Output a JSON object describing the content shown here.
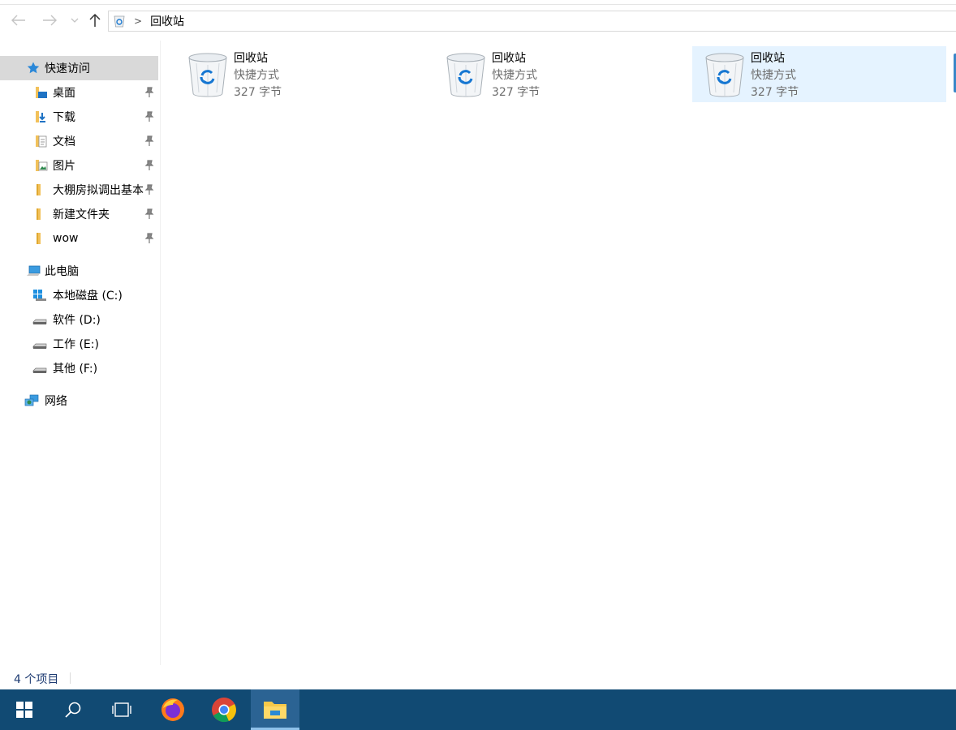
{
  "address": {
    "path_label": "回收站"
  },
  "sidebar": {
    "quick_access": "快速访问",
    "pinned": [
      {
        "label": "桌面",
        "icon": "desktop-folder-icon"
      },
      {
        "label": "下载",
        "icon": "downloads-folder-icon"
      },
      {
        "label": "文档",
        "icon": "documents-folder-icon"
      },
      {
        "label": "图片",
        "icon": "pictures-folder-icon"
      },
      {
        "label": "大棚房拟调出基本",
        "icon": "folder-icon"
      },
      {
        "label": "新建文件夹",
        "icon": "folder-icon"
      },
      {
        "label": "wow",
        "icon": "folder-icon"
      }
    ],
    "this_pc": "此电脑",
    "drives": [
      {
        "label": "本地磁盘 (C:)",
        "icon": "windows-drive-icon"
      },
      {
        "label": "软件 (D:)",
        "icon": "drive-icon"
      },
      {
        "label": "工作 (E:)",
        "icon": "drive-icon"
      },
      {
        "label": "其他 (F:)",
        "icon": "drive-icon"
      }
    ],
    "network": "网络"
  },
  "items": [
    {
      "name": "回收站",
      "type": "快捷方式",
      "size": "327 字节"
    },
    {
      "name": "回收站",
      "type": "快捷方式",
      "size": "327 字节"
    },
    {
      "name": "回收站",
      "type": "快捷方式",
      "size": "327 字节"
    }
  ],
  "status": {
    "count": "4 个项目"
  },
  "colors": {
    "taskbar": "#114a73",
    "selection": "#e5f3ff",
    "sidebar_selected": "#d9d9d9",
    "status_text": "#1e3b72"
  }
}
